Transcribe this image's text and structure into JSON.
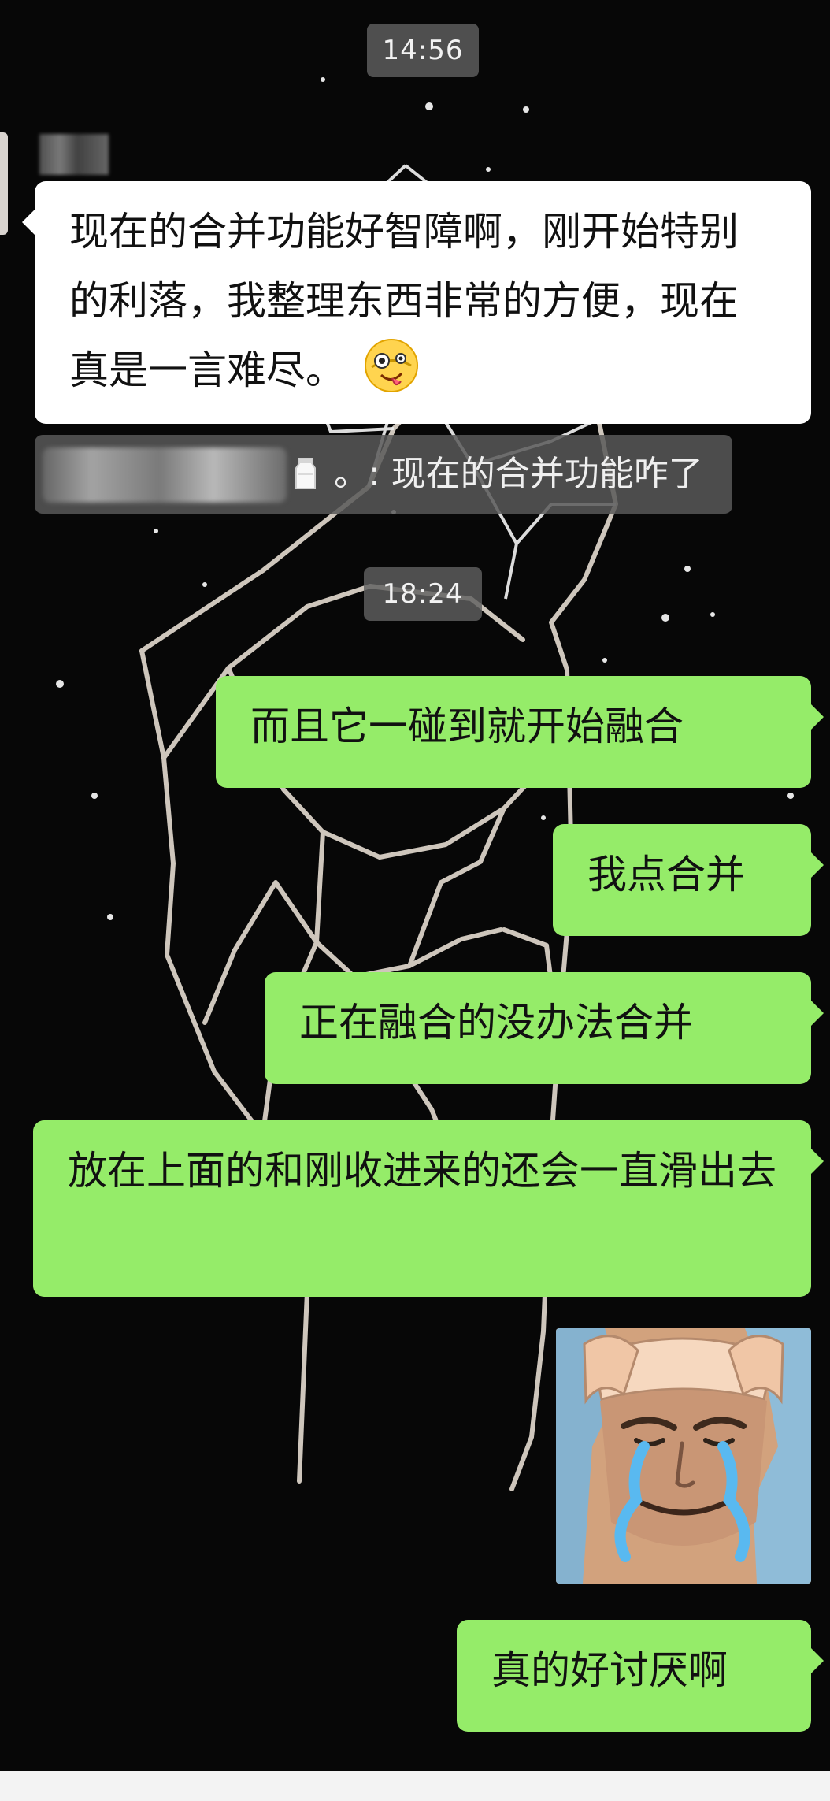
{
  "chat": {
    "timestamps": {
      "first": "14:56",
      "second": "18:24"
    },
    "left_message": {
      "text": "现在的合并功能好智障啊，刚开始特别的利落，我整理东西非常的方便，现在真是一言难尽。"
    },
    "quote": {
      "text": "。: 现在的合并功能咋了"
    },
    "right_messages": [
      "而且它一碰到就开始融合",
      "我点合并",
      "正在融合的没办法合并",
      "放在上面的和刚收进来的还会一直滑出去",
      "真的好讨厌啊"
    ],
    "emojis": {
      "left_message_emoji": "zany-face-emoji",
      "quote_icon": "milk-icon"
    }
  },
  "colors": {
    "background": "#070707",
    "left_bubble": "#ffffff",
    "right_bubble": "#95ec69",
    "time_pill": "#5f5f5f"
  }
}
